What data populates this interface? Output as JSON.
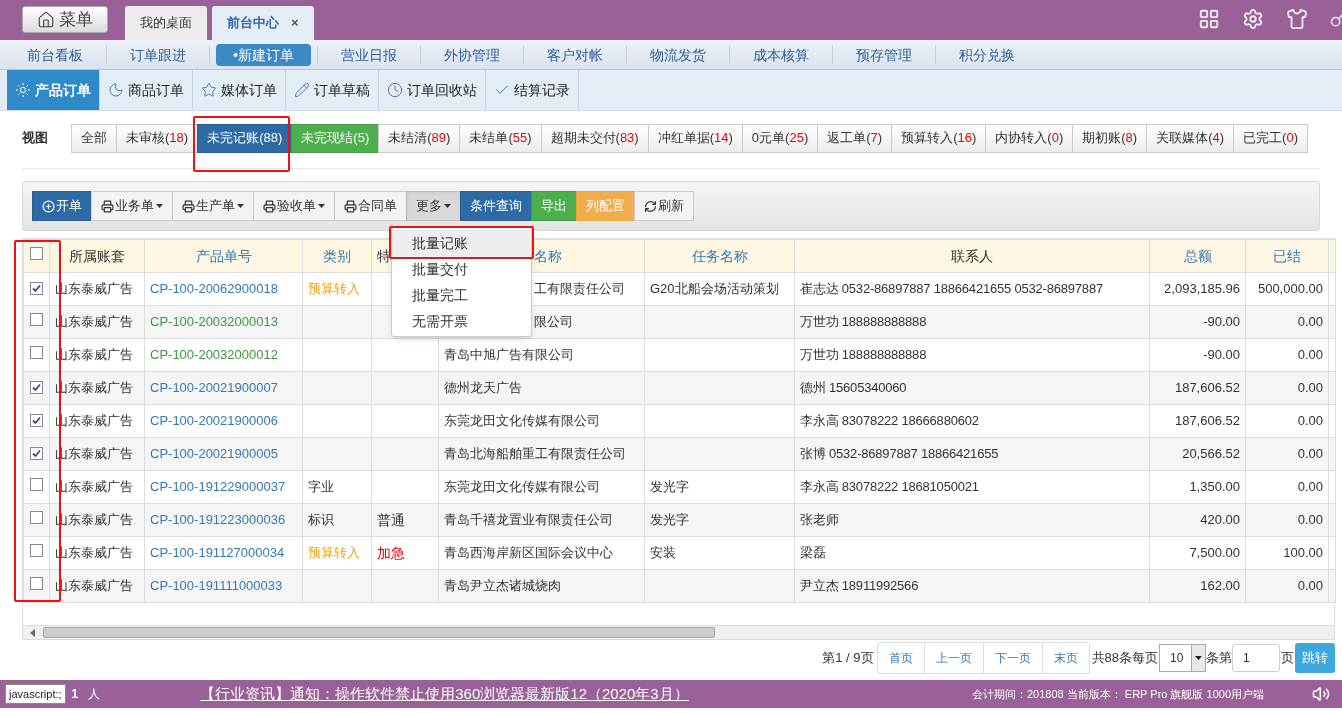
{
  "header": {
    "menu_button": "菜单",
    "tabs": [
      {
        "label": "我的桌面",
        "selected": false
      },
      {
        "label": "前台中心",
        "selected": true,
        "close": "×"
      }
    ]
  },
  "nav": [
    {
      "label": "前台看板",
      "selected": false
    },
    {
      "label": "订单跟进",
      "selected": false
    },
    {
      "label": "•新建订单",
      "selected": true
    },
    {
      "label": "营业日报",
      "selected": false
    },
    {
      "label": "外协管理",
      "selected": false
    },
    {
      "label": "客户对帐",
      "selected": false
    },
    {
      "label": "物流发货",
      "selected": false
    },
    {
      "label": "成本核算",
      "selected": false
    },
    {
      "label": "预存管理",
      "selected": false
    },
    {
      "label": "积分兑换",
      "selected": false
    }
  ],
  "subtabs": [
    {
      "label": "产品订单",
      "kind": "sun",
      "selected": true
    },
    {
      "label": "商品订单",
      "kind": "moon",
      "selected": false
    },
    {
      "label": "媒体订单",
      "kind": "star",
      "selected": false
    },
    {
      "label": "订单草稿",
      "kind": "pencil",
      "selected": false
    },
    {
      "label": "订单回收站",
      "kind": "clock",
      "selected": false
    },
    {
      "label": "结算记录",
      "kind": "check",
      "selected": false
    }
  ],
  "views": {
    "label": "视图",
    "tabs": [
      {
        "label": "全部",
        "kind": "default",
        "selected": false
      },
      {
        "label": "未审核(",
        "count": "18",
        "close": ")",
        "kind": "default",
        "selected": false
      },
      {
        "label": "未完记账(",
        "count": "88",
        "close": ")",
        "kind": "default",
        "selected": true
      },
      {
        "label": "未完现结(",
        "count": "5",
        "close": ")",
        "kind": "success",
        "selected": false
      },
      {
        "label": "未结清(",
        "count": "89",
        "close": ")",
        "kind": "default",
        "selected": false
      },
      {
        "label": "未结单(",
        "count": "55",
        "close": ")",
        "kind": "default",
        "selected": false
      },
      {
        "label": "超期未交付(",
        "count": "83",
        "close": ")",
        "kind": "default",
        "selected": false
      },
      {
        "label": "冲红单据(",
        "count": "14",
        "close": ")",
        "kind": "default",
        "selected": false
      },
      {
        "label": "0元单(",
        "count": "25",
        "close": ")",
        "kind": "default",
        "selected": false
      },
      {
        "label": "返工单(",
        "count": "7",
        "close": ")",
        "kind": "default",
        "selected": false
      },
      {
        "label": "预算转入(",
        "count": "16",
        "close": ")",
        "kind": "default",
        "selected": false
      },
      {
        "label": "内协转入(",
        "count": "0",
        "close": ")",
        "kind": "default",
        "selected": false
      },
      {
        "label": "期初账(",
        "count": "8",
        "close": ")",
        "kind": "default",
        "selected": false
      },
      {
        "label": "关联媒体(",
        "count": "4",
        "close": ")",
        "kind": "default",
        "selected": false
      },
      {
        "label": "已完工(",
        "count": "0",
        "close": ")",
        "kind": "default",
        "selected": false
      }
    ]
  },
  "toolbar": [
    {
      "label": "开单",
      "kind": "add"
    },
    {
      "label": "业务单",
      "kind": "print-menu"
    },
    {
      "label": "生产单",
      "kind": "print-menu"
    },
    {
      "label": "验收单",
      "kind": "print-menu"
    },
    {
      "label": "合同单",
      "kind": "print"
    },
    {
      "label": "更多",
      "kind": "menu",
      "expanded": true
    },
    {
      "label": "条件查询",
      "kind": "query"
    },
    {
      "label": "导出",
      "kind": "export"
    },
    {
      "label": "列配置",
      "kind": "columns"
    },
    {
      "label": "刷新",
      "kind": "refresh"
    }
  ],
  "more_menu": [
    {
      "label": "批量记账",
      "selected": true
    },
    {
      "label": "批量交付",
      "selected": false
    },
    {
      "label": "批量完工",
      "selected": false
    },
    {
      "label": "无需开票",
      "selected": false
    }
  ],
  "table": {
    "select_all": false,
    "columns": [
      {
        "label": "所属账套",
        "sortable": false
      },
      {
        "label": "产品单号",
        "sortable": true
      },
      {
        "label": "类别",
        "sortable": true
      },
      {
        "label": "特",
        "sortable": false,
        "cut_end": true
      },
      {
        "label": "名称",
        "sortable": true,
        "cut_start": true
      },
      {
        "label": "任务名称",
        "sortable": true
      },
      {
        "label": "联系人",
        "sortable": false
      },
      {
        "label": "总额",
        "sortable": true
      },
      {
        "label": "已结",
        "sortable": true
      }
    ],
    "rows": [
      {
        "checked": true,
        "account": "山东泰威广告",
        "number": {
          "text": "CP-100-20062900018",
          "color": "#337ab7"
        },
        "category": {
          "text": "预算转入",
          "color": "#f0a30a"
        },
        "customer": {
          "text": "工有限责任公司",
          "cut_start": true
        },
        "task": "G20北船会场活动策划",
        "contact": "崔志达 0532-86897887 18866421655 0532-86897887",
        "total": "2,093,185.96",
        "settled": "500,000.00"
      },
      {
        "checked": false,
        "account": "山东泰威广告",
        "number": {
          "text": "CP-100-20032000013",
          "color": "#3c9a3c"
        },
        "customer": {
          "text": "限公司",
          "cut_start": true
        },
        "contact": "万世功 188888888888",
        "total": "-90.00",
        "settled": "0.00"
      },
      {
        "checked": false,
        "account": "山东泰威广告",
        "number": {
          "text": "CP-100-20032000012",
          "color": "#3c9a3c"
        },
        "customer": {
          "text": "青岛中旭广告有限公司"
        },
        "contact": "万世功 188888888888",
        "total": "-90.00",
        "settled": "0.00"
      },
      {
        "checked": true,
        "account": "山东泰威广告",
        "number": {
          "text": "CP-100-20021900007",
          "color": "#337ab7"
        },
        "customer": {
          "text": "德州龙天广告"
        },
        "contact": "德州 15605340060",
        "total": "187,606.52",
        "settled": "0.00"
      },
      {
        "checked": true,
        "account": "山东泰威广告",
        "number": {
          "text": "CP-100-20021900006",
          "color": "#337ab7"
        },
        "customer": {
          "text": "东莞龙田文化传媒有限公司"
        },
        "contact": "李永高 83078222 18666880602",
        "total": "187,606.52",
        "settled": "0.00"
      },
      {
        "checked": true,
        "account": "山东泰威广告",
        "number": {
          "text": "CP-100-20021900005",
          "color": "#337ab7"
        },
        "customer": {
          "text": "青岛北海船舶重工有限责任公司"
        },
        "contact": "张博 0532-86897887 18866421655",
        "total": "20,566.52",
        "settled": "0.00"
      },
      {
        "checked": false,
        "account": "山东泰威广告",
        "number": {
          "text": "CP-100-191229000037",
          "color": "#337ab7"
        },
        "category": {
          "text": "字业",
          "color": "#333333"
        },
        "customer": {
          "text": "东莞龙田文化传媒有限公司"
        },
        "task": "发光字",
        "contact": "李永高 83078222 18681050021",
        "total": "1,350.00",
        "settled": "0.00"
      },
      {
        "checked": false,
        "account": "山东泰威广告",
        "number": {
          "text": "CP-100-191223000036",
          "color": "#337ab7"
        },
        "category": {
          "text": "标识",
          "color": "#333333"
        },
        "special": {
          "text": "普通",
          "color": "#333333"
        },
        "customer": {
          "text": "青岛千禧龙置业有限责任公司"
        },
        "task": "发光字",
        "contact": "张老师",
        "total": "420.00",
        "settled": "0.00"
      },
      {
        "checked": false,
        "account": "山东泰威广告",
        "number": {
          "text": "CP-100-191127000034",
          "color": "#337ab7"
        },
        "category": {
          "text": "预算转入",
          "color": "#f0a30a"
        },
        "special": {
          "text": "加急",
          "color": "#ee0000"
        },
        "customer": {
          "text": "青岛西海岸新区国际会议中心"
        },
        "task": "安装",
        "contact": "梁磊",
        "total": "7,500.00",
        "settled": "100.00"
      },
      {
        "checked": false,
        "account": "山东泰威广告",
        "number": {
          "text": "CP-100-191111000033",
          "color": "#337ab7"
        },
        "customer": {
          "text": "青岛尹立杰诸城烧肉"
        },
        "contact": "尹立杰 18911992566",
        "total": "162.00",
        "settled": "0.00"
      }
    ]
  },
  "pager": {
    "info": "第1 / 9页",
    "buttons": [
      "首页",
      "上一页",
      "下一页",
      "末页"
    ],
    "total": "共88条每页",
    "per_page": "10",
    "goto_prefix": "条第",
    "page": "1",
    "goto_suffix": "页",
    "go": "跳转"
  },
  "status": {
    "link_tip": "javascript:;",
    "online": "1",
    "online_unit": "人",
    "news": "【行业资讯】通知：操作软件禁止使用360浏览器最新版12（2020年3月）",
    "info": "会计期间：201808 当前版本： ERP Pro 旗舰版 1000用户端"
  }
}
